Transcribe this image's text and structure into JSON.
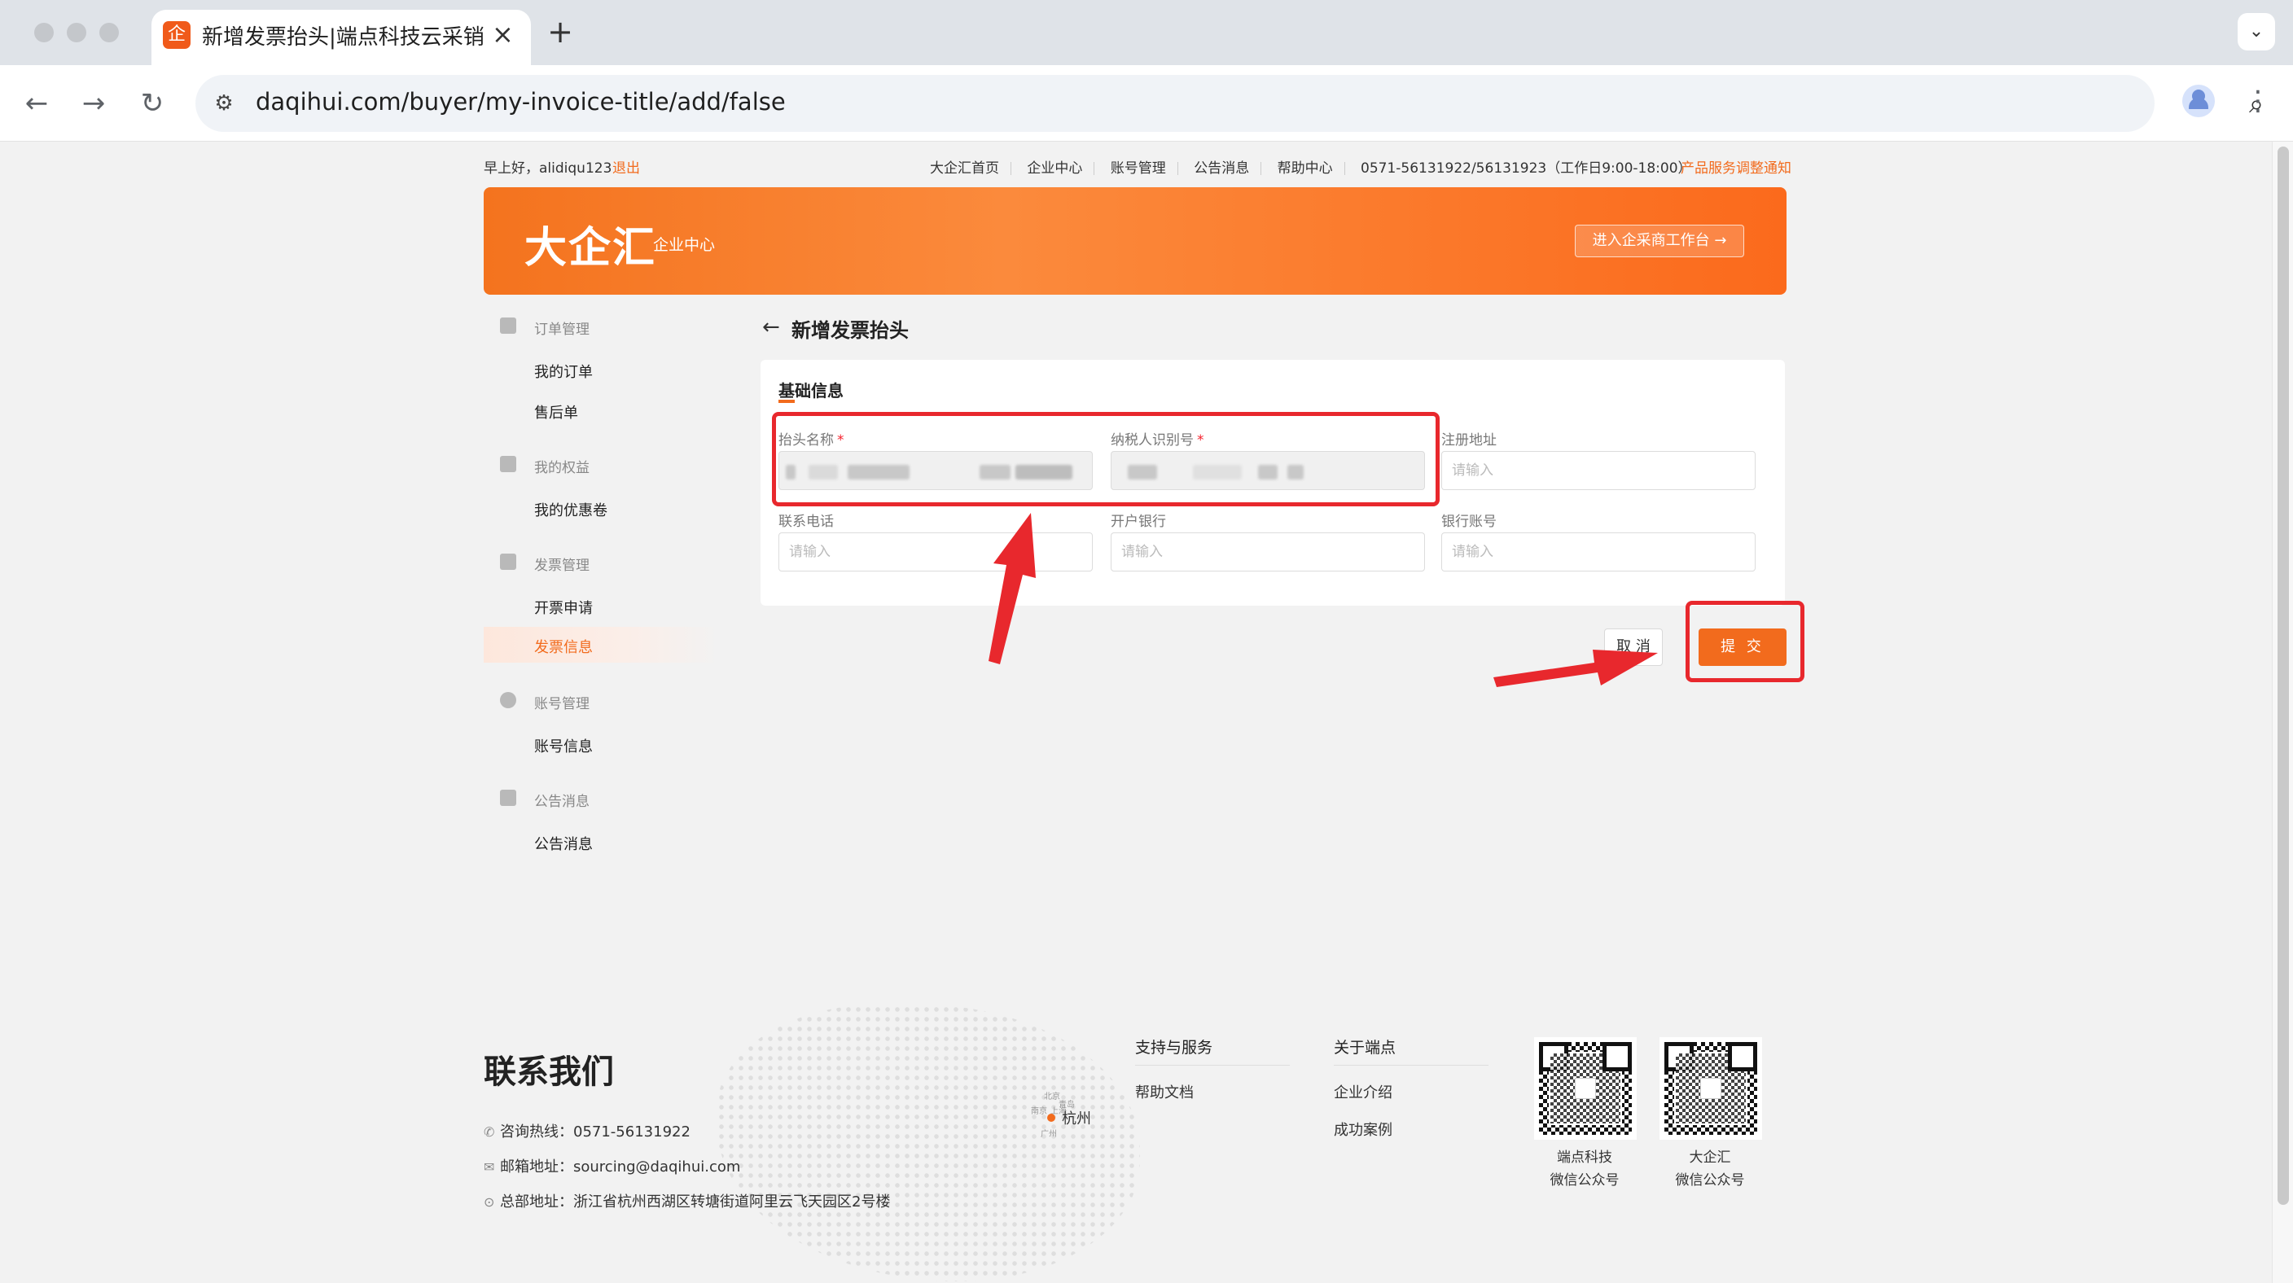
{
  "browser": {
    "tab_title": "新增发票抬头|端点科技云采销",
    "favicon_char": "企",
    "url": "daqihui.com/buyer/my-invoice-title/add/false"
  },
  "topbar": {
    "greeting": "早上好，alidiqu123",
    "logout": "退出",
    "links": [
      "大企汇首页",
      "企业中心",
      "账号管理",
      "公告消息",
      "帮助中心"
    ],
    "hotline": "0571-56131922/56131923（工作日9:00-18:00）",
    "notice": "产品服务调整通知"
  },
  "banner": {
    "logo": "大企汇",
    "subtitle": "企业中心",
    "workbench_button": "进入企采商工作台 →"
  },
  "sidebar": {
    "groups": [
      {
        "label": "订单管理",
        "items": [
          "我的订单",
          "售后单"
        ]
      },
      {
        "label": "我的权益",
        "items": [
          "我的优惠卷"
        ]
      },
      {
        "label": "发票管理",
        "items": [
          "开票申请",
          "发票信息"
        ]
      },
      {
        "label": "账号管理",
        "items": [
          "账号信息"
        ]
      },
      {
        "label": "公告消息",
        "items": [
          "公告消息"
        ]
      }
    ],
    "active_item": "发票信息"
  },
  "form": {
    "page_title": "新增发票抬头",
    "section_title": "基础信息",
    "fields": {
      "title_name": {
        "label": "抬头名称",
        "required": "*"
      },
      "tax_id": {
        "label": "纳税人识别号",
        "required": "*"
      },
      "reg_address": {
        "label": "注册地址",
        "placeholder": "请输入"
      },
      "phone": {
        "label": "联系电话",
        "placeholder": "请输入"
      },
      "bank": {
        "label": "开户银行",
        "placeholder": "请输入"
      },
      "bank_account": {
        "label": "银行账号",
        "placeholder": "请输入"
      }
    },
    "cancel_button": "取 消",
    "submit_button": "提 交"
  },
  "annotations": {
    "color": "#e8282d"
  },
  "footer": {
    "contact_title": "联系我们",
    "hotline": "咨询热线：0571-56131922",
    "email": "邮箱地址：sourcing@daqihui.com",
    "address": "总部地址：浙江省杭州西湖区转塘街道阿里云飞天园区2号楼",
    "city": "杭州",
    "mini_cities": [
      "北京",
      "青岛",
      "上海",
      "南京",
      "广州"
    ],
    "support_title": "支持与服务",
    "support_links": [
      "帮助文档"
    ],
    "about_title": "关于端点",
    "about_links": [
      "企业介绍",
      "成功案例"
    ],
    "qr_codes": [
      {
        "line1": "端点科技",
        "line2": "微信公众号"
      },
      {
        "line1": "大企汇",
        "line2": "微信公众号"
      }
    ]
  },
  "colors": {
    "brand": "#f26b1d",
    "required": "#f5222d"
  }
}
